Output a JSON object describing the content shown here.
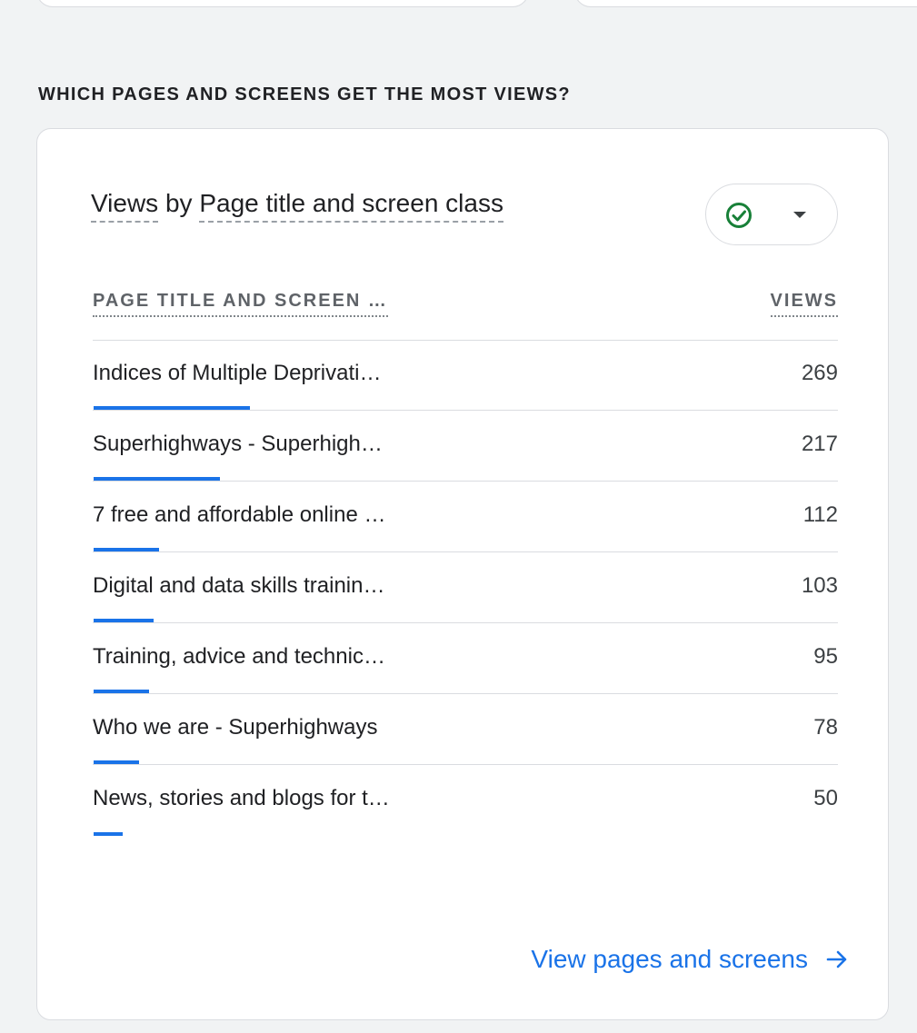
{
  "section": {
    "heading": "WHICH PAGES AND SCREENS GET THE MOST VIEWS?"
  },
  "card": {
    "title_part1": "Views",
    "title_by": " by ",
    "title_part2": "Page title and screen class",
    "status_icon": "check-circle-icon",
    "status_color": "#188038",
    "dropdown_icon": "caret-down-icon"
  },
  "table": {
    "headers": {
      "title": "PAGE TITLE AND SCREEN …",
      "views": "VIEWS"
    },
    "max_value": 269,
    "rows": [
      {
        "label": "Indices of Multiple Deprivati…",
        "value": 269
      },
      {
        "label": "Superhighways - Superhigh…",
        "value": 217
      },
      {
        "label": "7 free and affordable online …",
        "value": 112
      },
      {
        "label": "Digital and data skills trainin…",
        "value": 103
      },
      {
        "label": "Training, advice and technic…",
        "value": 95
      },
      {
        "label": "Who we are - Superhighways",
        "value": 78
      },
      {
        "label": "News, stories and blogs for t…",
        "value": 50
      }
    ]
  },
  "footer": {
    "link_label": "View pages and screens",
    "link_icon": "arrow-right-icon"
  },
  "colors": {
    "accent": "#1a73e8",
    "background": "#f1f3f4",
    "card": "#ffffff",
    "border": "#dadce0"
  }
}
